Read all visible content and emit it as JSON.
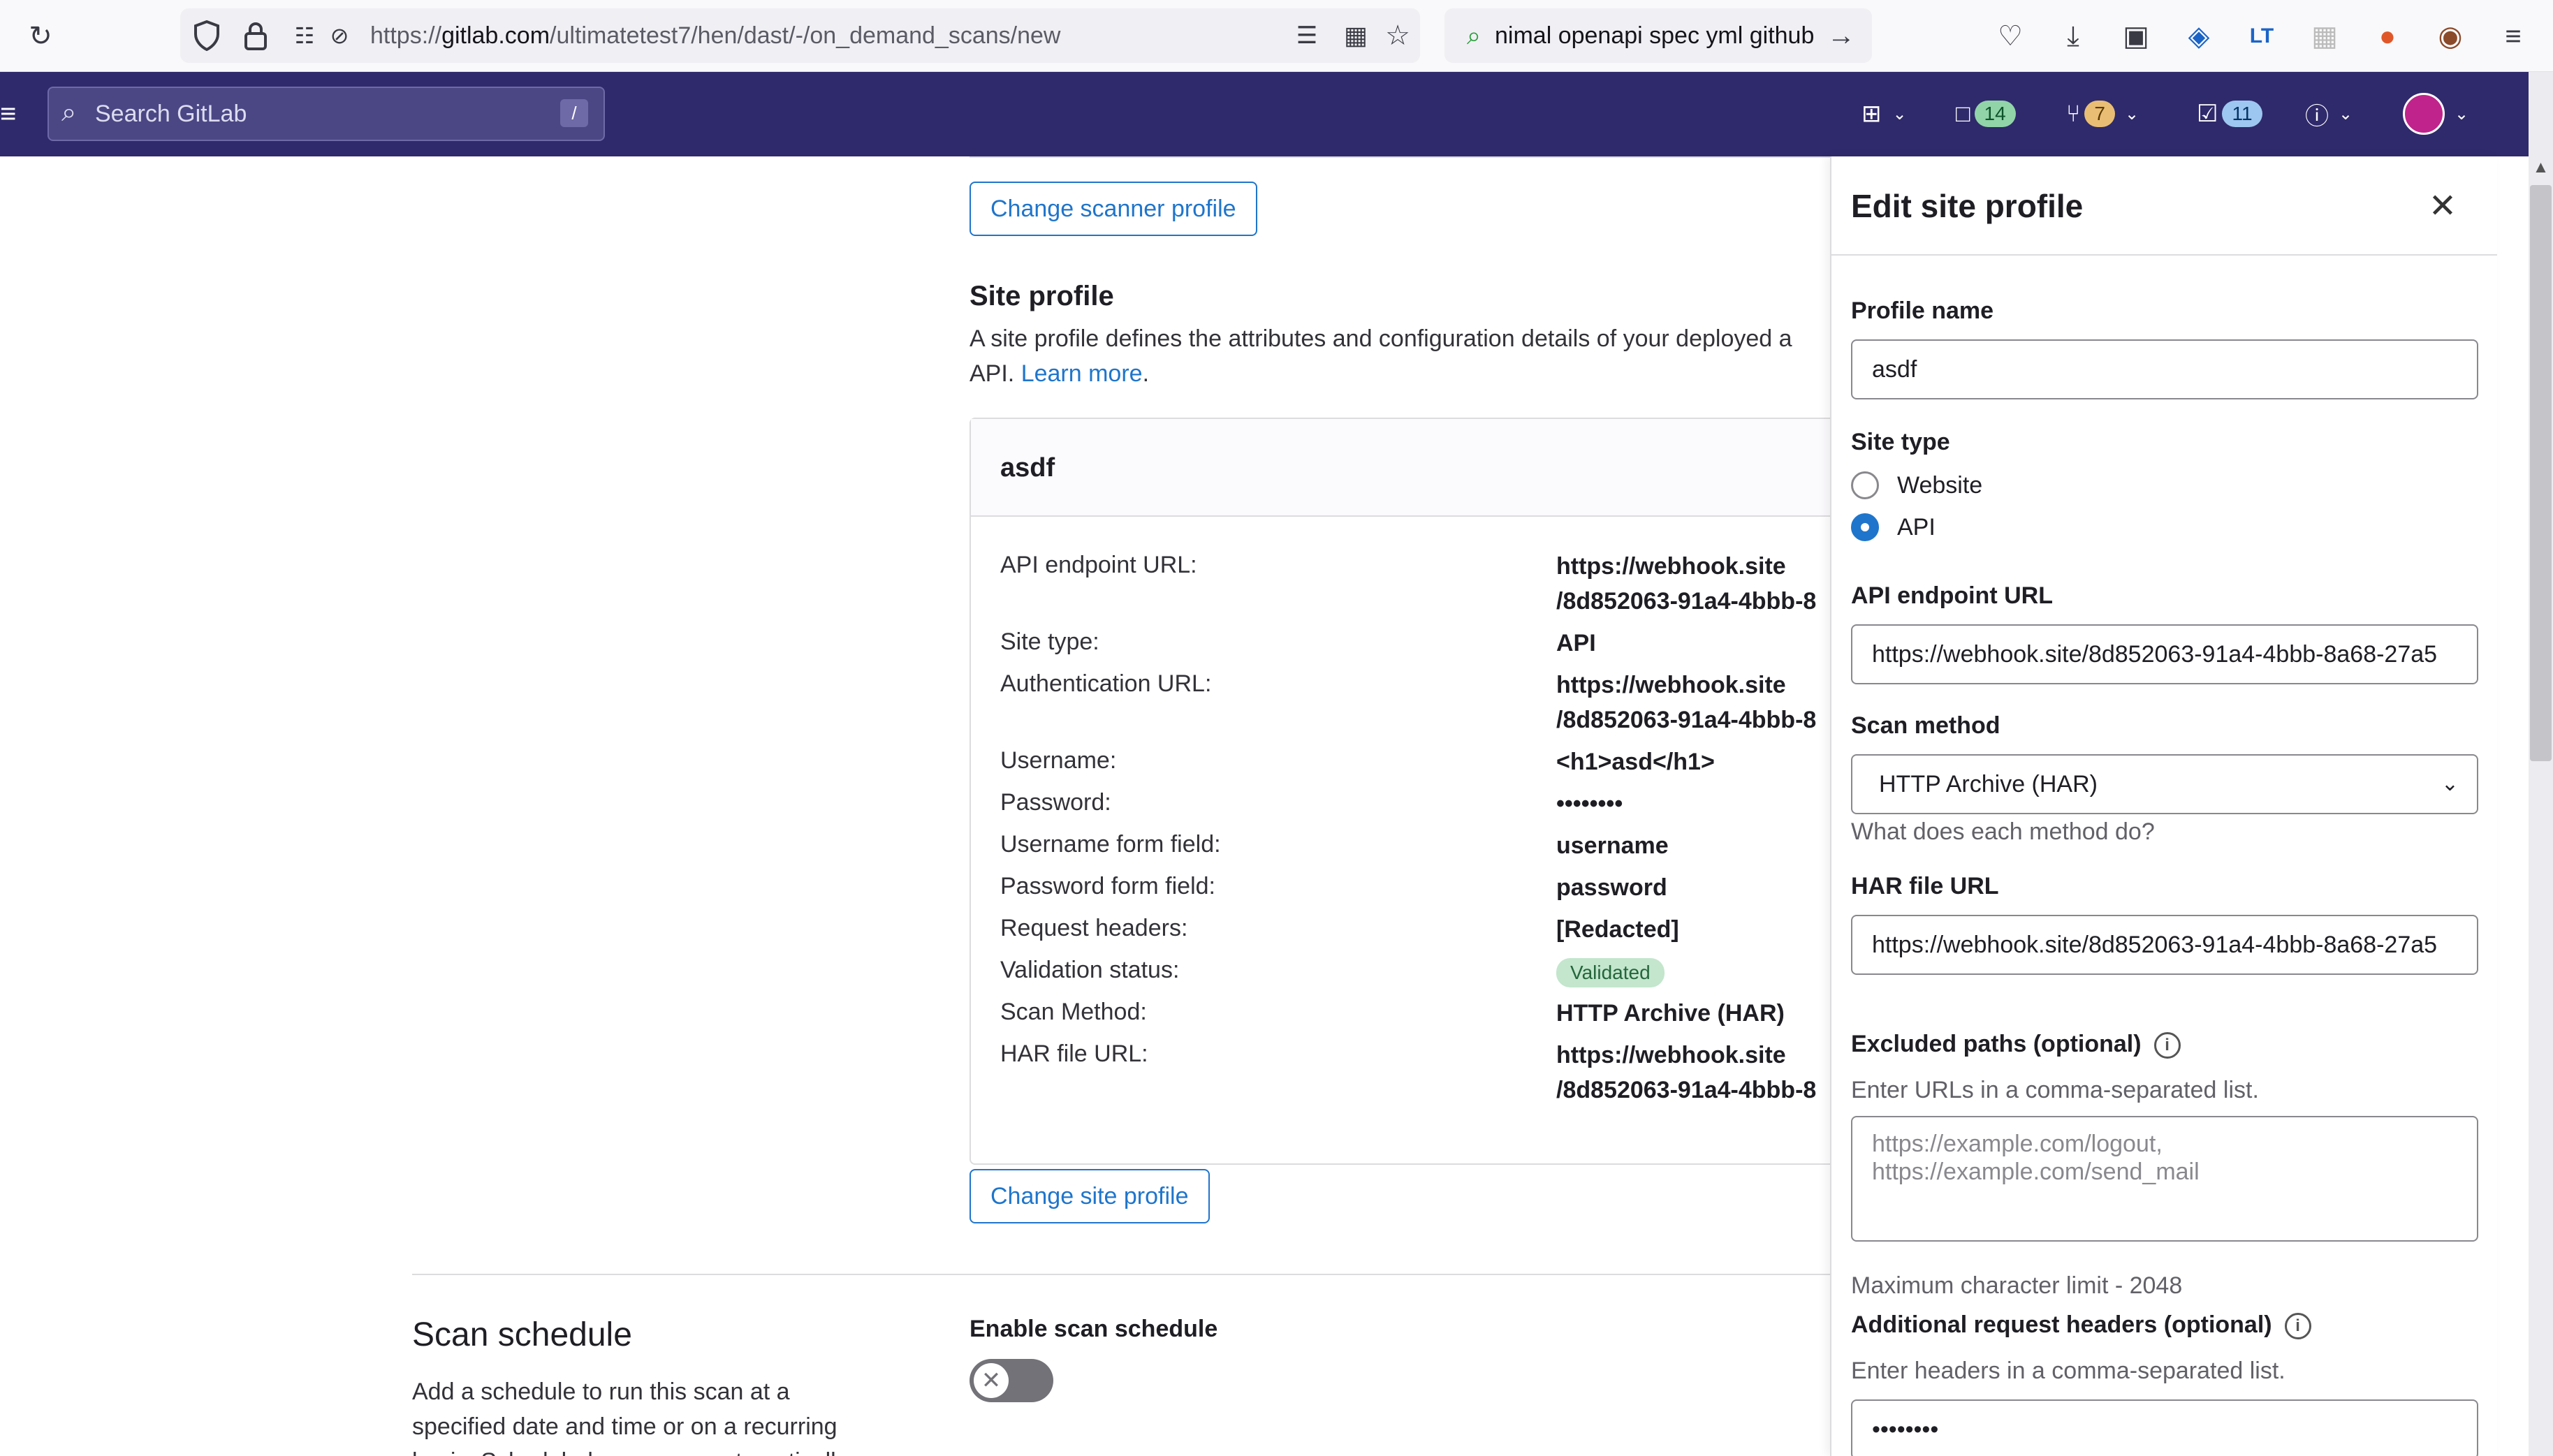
{
  "browser": {
    "url_prefix": "https://",
    "url_domain": "gitlab.com",
    "url_path": "/ultimatetest7/hen/dast/-/on_demand_scans/new",
    "search_text": "nimal openapi spec yml github"
  },
  "header": {
    "search_placeholder": "Search GitLab",
    "search_shortcut": "/",
    "issues_count": "14",
    "merge_requests_count": "7",
    "todos_count": "11"
  },
  "main": {
    "change_scanner_label": "Change scanner profile",
    "site_profile_heading": "Site profile",
    "site_profile_desc_line1": "A site profile defines the attributes and configuration details of your deployed a",
    "site_profile_desc_line2": "API.",
    "learn_more": "Learn more",
    "profile_card": {
      "title": "asdf",
      "rows": [
        {
          "label": "API endpoint URL:",
          "value": "https://webhook.site",
          "value2": "/8d852063-91a4-4bbb-8"
        },
        {
          "label": "Site type:",
          "value": "API"
        },
        {
          "label": "Authentication URL:",
          "value": "https://webhook.site",
          "value2": "/8d852063-91a4-4bbb-8"
        },
        {
          "label": "Username:",
          "value": "<h1>asd</h1>"
        },
        {
          "label": "Password:",
          "value": "••••••••"
        },
        {
          "label": "Username form field:",
          "value": "username"
        },
        {
          "label": "Password form field:",
          "value": "password"
        },
        {
          "label": "Request headers:",
          "value": "[Redacted]"
        },
        {
          "label": "Validation status:",
          "value": "Validated"
        },
        {
          "label": "Scan Method:",
          "value": "HTTP Archive (HAR)"
        },
        {
          "label": "HAR file URL:",
          "value": "https://webhook.site",
          "value2": "/8d852063-91a4-4bbb-8"
        }
      ]
    },
    "change_site_label": "Change site profile",
    "scan_schedule_heading": "Scan schedule",
    "scan_schedule_desc_line1": "Add a schedule to run this scan at a",
    "scan_schedule_desc_line2": "specified date and time or on a recurring",
    "scan_schedule_desc_line3": "basis. Scheduled scans are automatically",
    "enable_schedule_label": "Enable scan schedule"
  },
  "drawer": {
    "title": "Edit site profile",
    "profile_name_label": "Profile name",
    "profile_name_value": "asdf",
    "site_type_label": "Site type",
    "site_type_website": "Website",
    "site_type_api": "API",
    "api_endpoint_label": "API endpoint URL",
    "api_endpoint_value": "https://webhook.site/8d852063-91a4-4bbb-8a68-27a5",
    "scan_method_label": "Scan method",
    "scan_method_value": "HTTP Archive (HAR)",
    "scan_method_help": "What does each method do?",
    "har_url_label": "HAR file URL",
    "har_url_value": "https://webhook.site/8d852063-91a4-4bbb-8a68-27a5",
    "excluded_paths_label": "Excluded paths (optional)",
    "excluded_paths_help": "Enter URLs in a comma-separated list.",
    "excluded_paths_placeholder": "https://example.com/logout, https://example.com/send_mail",
    "char_limit": "Maximum character limit - 2048",
    "headers_label": "Additional request headers (optional)",
    "headers_help": "Enter headers in a comma-separated list.",
    "headers_value": "••••••••"
  },
  "colors": {
    "header_bg": "#2f2a6b",
    "link": "#1f75cb",
    "validated_bg": "#c3e6cd"
  }
}
